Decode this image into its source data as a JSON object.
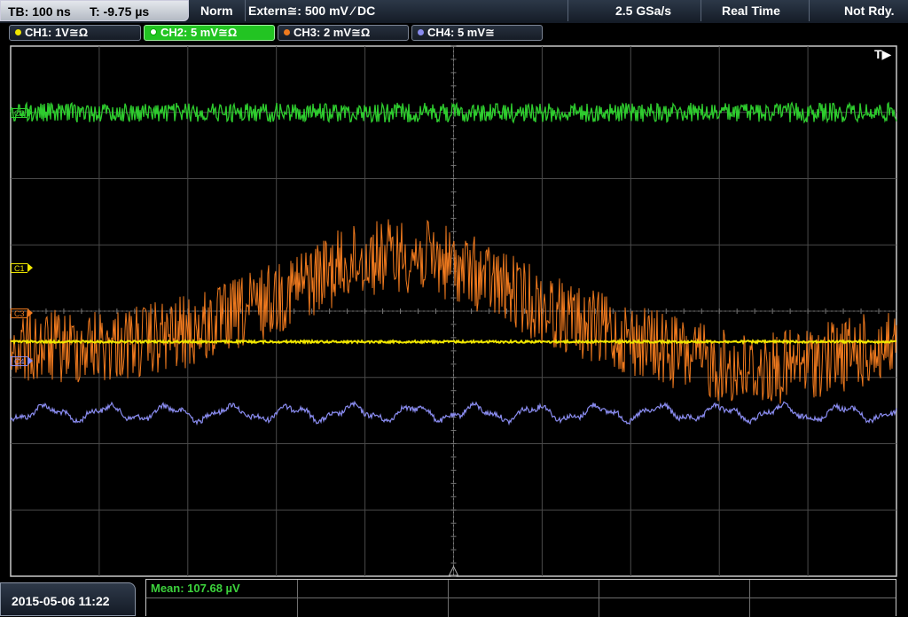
{
  "status_bar": {
    "timebase": "TB: 100 ns",
    "trigger_time": "T: -9.75 µs",
    "mode": "Norm",
    "trigger_source": "Extern≅: 500 mV ⁄ DC",
    "sample_rate": "2.5 GSa/s",
    "acquisition": "Real Time",
    "status": "Not Rdy."
  },
  "channels": [
    {
      "label": "CH1: 1V≅Ω",
      "color": "#f0e600",
      "active": false
    },
    {
      "label": "CH2: 5 mV≅Ω",
      "color": "#2ecc2e",
      "active": true
    },
    {
      "label": "CH3: 2 mV≅Ω",
      "color": "#f07a1e",
      "active": false
    },
    {
      "label": "CH4: 5 mV≅",
      "color": "#8a8cf0",
      "active": false
    }
  ],
  "markers": [
    {
      "label": "C2",
      "color": "#2ecc2e"
    },
    {
      "label": "C1",
      "color": "#f0e600"
    },
    {
      "label": "C3",
      "color": "#f07a1e"
    },
    {
      "label": "C4",
      "color": "#8a8cf0"
    }
  ],
  "trigger_indicator": "T▶",
  "footer": {
    "datetime": "2015-05-06 11:22",
    "measurement": "Mean: 107.68 µV"
  }
}
